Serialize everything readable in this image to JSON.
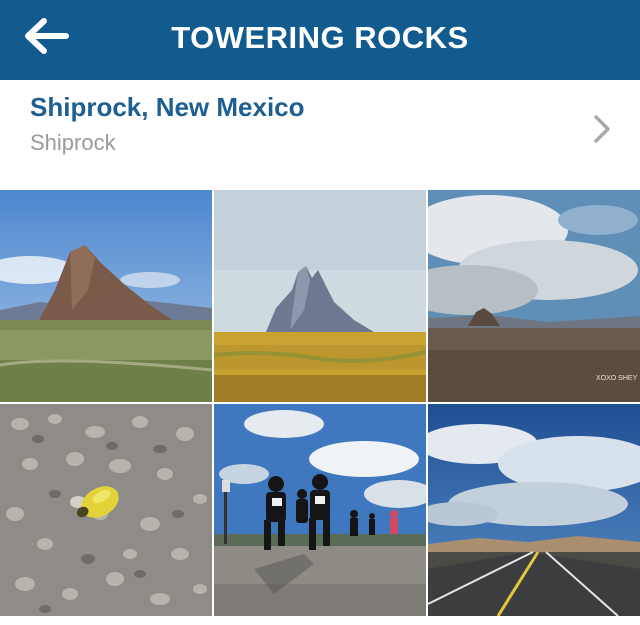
{
  "header": {
    "title": "TOWERING ROCKS",
    "back_icon": "arrow-left-icon",
    "background": "#115b8e"
  },
  "location": {
    "name": "Shiprock, New Mexico",
    "subtitle": "Shiprock",
    "chevron_icon": "chevron-right-icon",
    "name_color": "#1d5f92"
  },
  "photos": [
    {
      "name": "photo-shiprock-landscape"
    },
    {
      "name": "photo-shiprock-painting"
    },
    {
      "name": "photo-shiprock-clouds",
      "watermark": "XOXO SHEY"
    },
    {
      "name": "photo-gravel-beetle"
    },
    {
      "name": "photo-runners"
    },
    {
      "name": "photo-desert-road"
    }
  ]
}
